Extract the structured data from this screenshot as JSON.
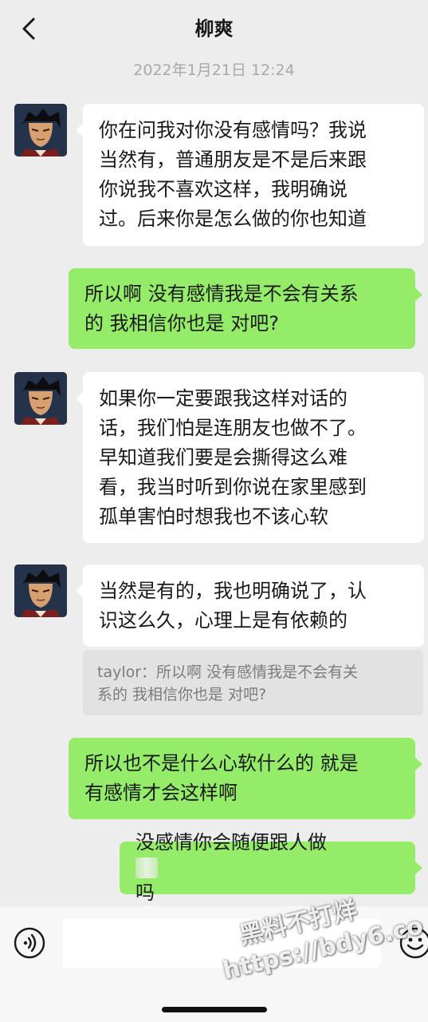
{
  "header": {
    "title": "柳爽"
  },
  "timestamp": "2022年1月21日 12:24",
  "messages": [
    {
      "side": "left",
      "text": "你在问我对你没有感情吗？我说当然有，普通朋友是不是后来跟你说我不喜欢这样，我明确说过。后来你是怎么做的你也知道",
      "lines": [
        "你在问我对你没有感情吗？我说",
        "当然有，普通朋友是不是后来跟",
        "你说我不喜欢这样，我明确说",
        "过。后来你是怎么做的你也知道"
      ]
    },
    {
      "side": "right",
      "text": "所以啊 没有感情我是不会有关系的 我相信你也是 对吧?",
      "lines": [
        "所以啊 没有感情我是不会有关系",
        "的 我相信你也是 对吧?"
      ]
    },
    {
      "side": "left",
      "text": "如果你一定要跟我这样对话的话，我们怕是连朋友也做不了。早知道我们要是会撕得这么难看，我当时听到你说在家里感到孤单害怕时想我也不该心软",
      "lines": [
        "如果你一定要跟我这样对话的",
        "话，我们怕是连朋友也做不了。",
        "早知道我们要是会撕得这么难",
        "看，我当时听到你说在家里感到",
        "孤单害怕时想我也不该心软"
      ]
    },
    {
      "side": "left",
      "text": "当然是有的，我也明确说了，认识这么久，心理上是有依赖的",
      "lines": [
        "当然是有的，我也明确说了，认",
        "识这么久，心理上是有依赖的"
      ]
    },
    {
      "side": "right",
      "text": "所以也不是什么心软什么的 就是有感情才会这样啊",
      "lines": [
        "所以也不是什么心软什么的 就是",
        "有感情才会这样啊"
      ]
    },
    {
      "side": "right",
      "text_before": "没感情你会随便跟人做",
      "text_after": "吗"
    }
  ],
  "quote": {
    "lines": [
      "taylor：所以啊 没有感情我是不会有关",
      "系的 我相信你也是 对吧?"
    ]
  },
  "input": {
    "value": ""
  },
  "watermark": {
    "line1": "黑料不打烊",
    "line2": "https://bdy6.co"
  },
  "icons": {
    "back": "chevron-left-icon",
    "voice": "voice-icon",
    "emoji": "emoji-icon"
  },
  "colors": {
    "background": "#ededed",
    "sent_bubble": "#95ec69",
    "received_bubble": "#ffffff"
  }
}
